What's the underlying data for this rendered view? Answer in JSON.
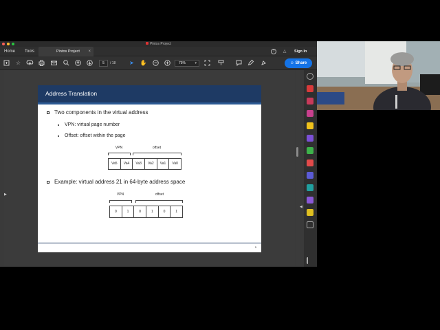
{
  "window": {
    "title": "Pintos Project"
  },
  "tabs": {
    "home": "Home",
    "tools": "Tools",
    "document": "Pintos Project",
    "close": "×"
  },
  "header": {
    "sign_in": "Sign In"
  },
  "toolbar": {
    "page_current": "5",
    "page_total": "/ 18",
    "zoom": "75%",
    "share": "Share"
  },
  "slide": {
    "title": "Address Translation",
    "bullet1": "Two components in the virtual address",
    "sub1": "VPN: virtual page number",
    "sub2": "Offset: offset within the page",
    "diagram1": {
      "vpn_label": "VPN",
      "offset_label": "offset",
      "cells": [
        "Va5",
        "Va4",
        "Va3",
        "Va2",
        "Va1",
        "Va0"
      ]
    },
    "bullet2": "Example: virtual address 21 in 64-byte address space",
    "diagram2": {
      "vpn_label": "VPN",
      "offset_label": "offset",
      "cells": [
        "0",
        "1",
        "0",
        "1",
        "0",
        "1"
      ]
    },
    "page_number": "5"
  },
  "colors": {
    "slide_header": "#1e3a64",
    "share_button": "#1473e6",
    "traffic_red": "#fe5f57",
    "traffic_yellow": "#febc2e",
    "traffic_green": "#28c840"
  },
  "icons": {
    "toolbar": [
      "create-icon",
      "bookmark-star-icon",
      "upload-icon",
      "print-icon",
      "mail-icon",
      "search-icon",
      "page-up-icon",
      "page-down-icon",
      "select-cursor-icon",
      "hand-icon",
      "zoom-out-icon",
      "zoom-in-icon",
      "fit-page-icon",
      "comment-icon",
      "pen-icon",
      "highlight-icon"
    ],
    "right_rail": [
      "zoom-icon",
      "export-pdf-icon",
      "create-pdf-icon",
      "edit-pdf-icon",
      "comment-icon",
      "combine-icon",
      "organize-icon",
      "redact-icon",
      "protect-icon",
      "optimize-icon",
      "fill-sign-icon",
      "send-icon",
      "more-tools-icon",
      "collapse-panel-icon"
    ]
  }
}
